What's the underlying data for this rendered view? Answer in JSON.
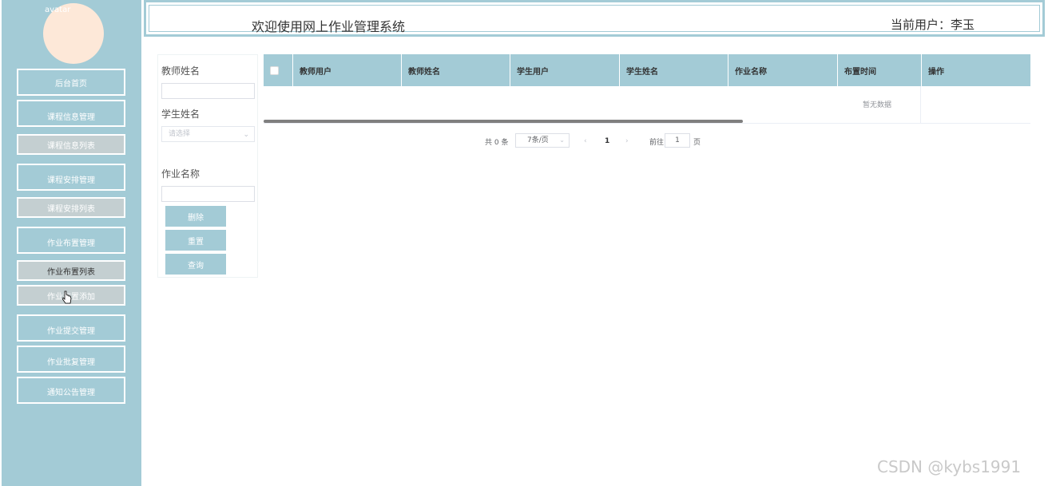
{
  "header": {
    "title": "欢迎使用网上作业管理系统",
    "current_user": "当前用户：李玉"
  },
  "sidebar": {
    "avatar_alt": "avatar",
    "items": [
      {
        "label": "后台首页"
      },
      {
        "label": "课程信息管理"
      },
      {
        "label": "课程信息列表"
      },
      {
        "label": "课程安排管理"
      },
      {
        "label": "课程安排列表"
      },
      {
        "label": "作业布置管理"
      },
      {
        "label": "作业布置列表"
      },
      {
        "label": "作业布置添加"
      },
      {
        "label": "作业提交管理"
      },
      {
        "label": "作业批复管理"
      },
      {
        "label": "通知公告管理"
      }
    ]
  },
  "search": {
    "teacher_name_label": "教师姓名",
    "student_name_label": "学生姓名",
    "student_name_placeholder": "请选择",
    "homework_name_label": "作业名称",
    "delete_label": "删除",
    "reset_label": "重置",
    "query_label": "查询"
  },
  "table": {
    "columns": [
      "教师用户",
      "教师姓名",
      "学生用户",
      "学生姓名",
      "作业名称",
      "布置时间",
      "操作"
    ],
    "empty_text": "暂无数据"
  },
  "pagination": {
    "total": "共 0 条",
    "page_size": "7条/页",
    "current_page": "1",
    "goto_label": "前往",
    "goto_value": "1",
    "page_unit": "页"
  },
  "watermark": "CSDN @kybs1991",
  "colors": {
    "accent": "#a3cbd6",
    "submenu": "#c4cfd1",
    "avatar": "#fde8d8"
  }
}
